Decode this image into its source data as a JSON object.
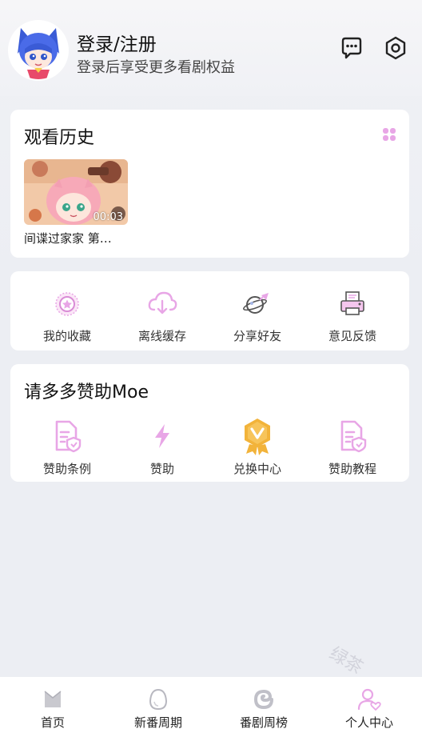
{
  "header": {
    "title": "登录/注册",
    "subtitle": "登录后享受更多看剧权益",
    "message_icon": "message-icon",
    "settings_icon": "gear-icon"
  },
  "history": {
    "title": "观看历史",
    "more_icon": "grid-icon",
    "items": [
      {
        "name": "间谍过家家 第…",
        "duration": "00:03"
      }
    ]
  },
  "tools": {
    "items": [
      {
        "label": "我的收藏",
        "icon": "star-badge-icon"
      },
      {
        "label": "离线缓存",
        "icon": "cloud-download-icon"
      },
      {
        "label": "分享好友",
        "icon": "share-planet-icon"
      },
      {
        "label": "意见反馈",
        "icon": "feedback-printer-icon"
      }
    ]
  },
  "sponsor": {
    "title": "请多多赞助Moe",
    "items": [
      {
        "label": "赞助条例",
        "icon": "document-shield-icon"
      },
      {
        "label": "赞助",
        "icon": "lightning-icon"
      },
      {
        "label": "兑换中心",
        "icon": "vip-badge-icon"
      },
      {
        "label": "赞助教程",
        "icon": "document-shield-icon"
      }
    ]
  },
  "tabbar": {
    "items": [
      {
        "label": "首页",
        "icon": "home-icon",
        "active": false
      },
      {
        "label": "新番周期",
        "icon": "egg-icon",
        "active": false
      },
      {
        "label": "番剧周榜",
        "icon": "swirl-icon",
        "active": false
      },
      {
        "label": "个人中心",
        "icon": "user-heart-icon",
        "active": true
      }
    ]
  },
  "watermark": "绿茶",
  "colors": {
    "accent": "#e8a6e6",
    "badge_gold": "#f2b33a",
    "card_bg": "#ffffff",
    "page_bg": "#eceef3"
  }
}
